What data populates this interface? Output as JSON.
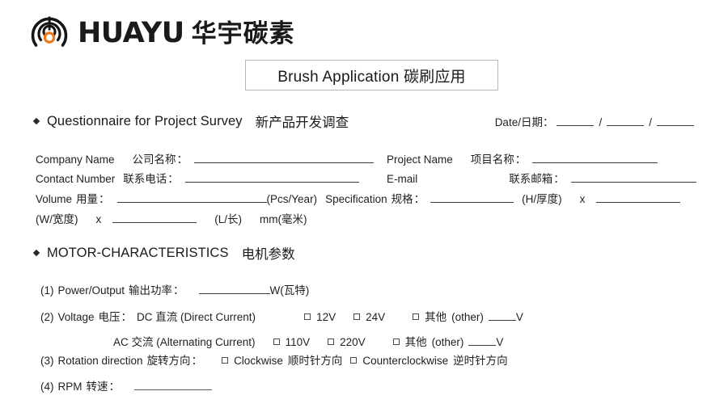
{
  "logo": {
    "mark_name": "huayu-emblem",
    "latin": "HUAYU",
    "chinese": "华宇碳素",
    "accent_color": "#E8781E",
    "ink_color": "#1a1a1a"
  },
  "title_box": {
    "text": "Brush Application 碳刷应用"
  },
  "section_survey": {
    "en": "Questionnaire for Project Survey",
    "cn": "新产品开发调查"
  },
  "date": {
    "label": "Date/日期：",
    "sep1": "/",
    "sep2": "/",
    "value_year": "",
    "value_month": "",
    "value_day": ""
  },
  "fields": {
    "company": {
      "en": "Company Name",
      "cn": "公司名称",
      "colon": "：",
      "value": ""
    },
    "project": {
      "en": "Project  Name",
      "cn": "项目名称",
      "colon": "：",
      "value": ""
    },
    "contact": {
      "en": "Contact Number",
      "cn": "联系电话",
      "colon": "：",
      "value": ""
    },
    "email": {
      "en": "E-mail",
      "cn": "联系邮箱",
      "colon": "：",
      "value": ""
    },
    "volume": {
      "en": "Volume",
      "cn": "用量",
      "colon": "：",
      "value": "",
      "unit": "(Pcs/Year)"
    },
    "specification": {
      "en": "Specification",
      "cn": "规格",
      "colon": "：",
      "value_h": "",
      "unit_h": "(H/厚度)",
      "times": "x",
      "value_w": "",
      "unit_w": "(W/宽度)",
      "times2": "x",
      "value_l": "",
      "unit_l": "(L/长)",
      "unit_mm": "mm(毫米)"
    }
  },
  "section_motor": {
    "en": "MOTOR-CHARACTERISTICS",
    "cn": "电机参数"
  },
  "motor": {
    "power": {
      "index": "(1)",
      "en": "Power/Output",
      "cn": "输出功率",
      "colon": "：",
      "value": "",
      "unit": "W(瓦特)"
    },
    "voltage": {
      "index": "(2)",
      "en": "Voltage",
      "cn": "电压",
      "colon": "：",
      "dc_label": "DC 直流 (Direct Current)",
      "dc_options": [
        "12V",
        "24V"
      ],
      "dc_other_cn": "其他",
      "dc_other_en": "(other)",
      "dc_other_value": "",
      "dc_other_unit": "V",
      "ac_label": "AC 交流 (Alternating Current)",
      "ac_options": [
        "110V",
        "220V"
      ],
      "ac_other_cn": "其他",
      "ac_other_en": "(other)",
      "ac_other_value": "",
      "ac_other_unit": "V"
    },
    "rotation": {
      "index": "(3)",
      "en": "Rotation direction",
      "cn": "旋转方向",
      "colon": "：",
      "options": [
        {
          "en": "Clockwise",
          "cn": "顺时针方向"
        },
        {
          "en": "Counterclockwise",
          "cn": "逆时针方向"
        }
      ]
    },
    "rpm": {
      "index": "(4)",
      "en": "RPM",
      "cn": "转速",
      "colon": "：",
      "value": ""
    }
  }
}
